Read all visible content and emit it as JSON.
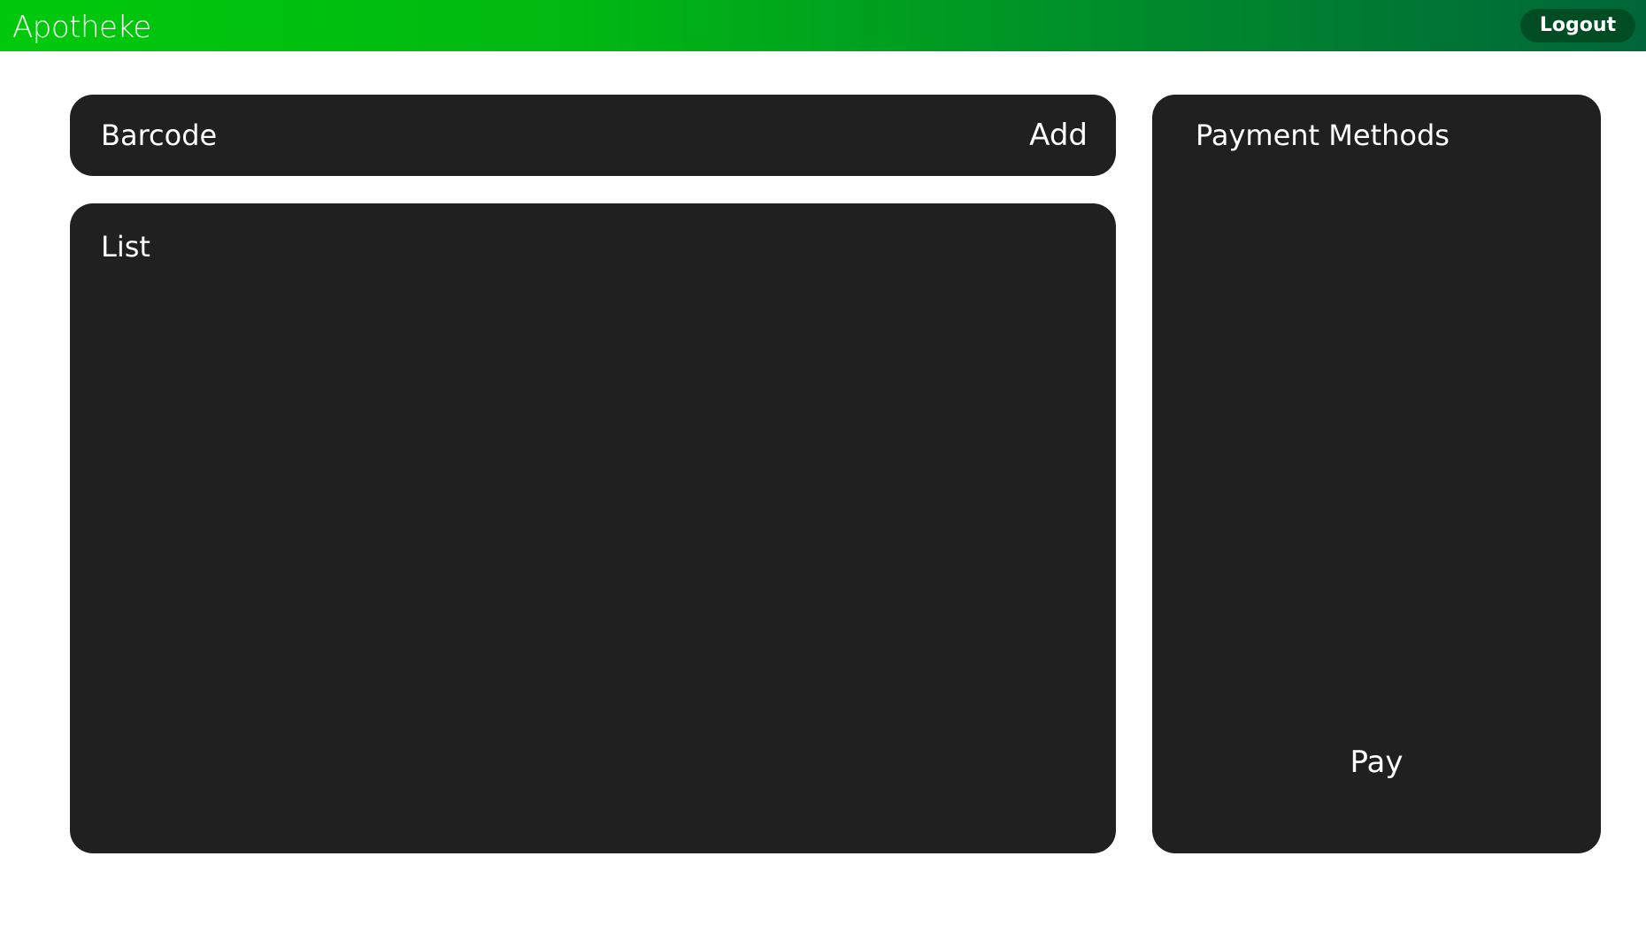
{
  "header": {
    "app_title": "Apotheke",
    "logout_label": "Logout"
  },
  "barcode": {
    "label": "Barcode",
    "add_label": "Add"
  },
  "list": {
    "label": "List"
  },
  "payment": {
    "label": "Payment Methods",
    "pay_label": "Pay"
  },
  "colors": {
    "header_gradient_start": "#00c90b",
    "header_gradient_end": "#00663a",
    "logout_bg": "#004d24",
    "panel_bg": "#202020",
    "page_bg": "#ffffff"
  }
}
